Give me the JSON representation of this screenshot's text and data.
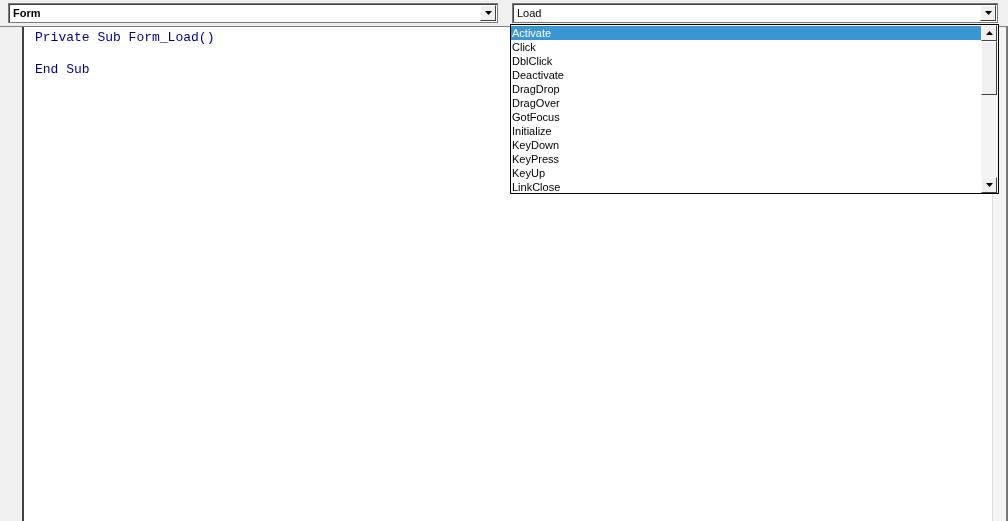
{
  "object_combo": {
    "value": "Form"
  },
  "procedure_combo": {
    "value": "Load",
    "expanded": true
  },
  "procedure_list": [
    {
      "label": "Activate",
      "selected": true
    },
    {
      "label": "Click",
      "selected": false
    },
    {
      "label": "DblClick",
      "selected": false
    },
    {
      "label": "Deactivate",
      "selected": false
    },
    {
      "label": "DragDrop",
      "selected": false
    },
    {
      "label": "DragOver",
      "selected": false
    },
    {
      "label": "GotFocus",
      "selected": false
    },
    {
      "label": "Initialize",
      "selected": false
    },
    {
      "label": "KeyDown",
      "selected": false
    },
    {
      "label": "KeyPress",
      "selected": false
    },
    {
      "label": "KeyUp",
      "selected": false
    },
    {
      "label": "LinkClose",
      "selected": false
    }
  ],
  "procedure": {
    "header": "Private Sub Form_Load()",
    "footer": "End Sub"
  }
}
